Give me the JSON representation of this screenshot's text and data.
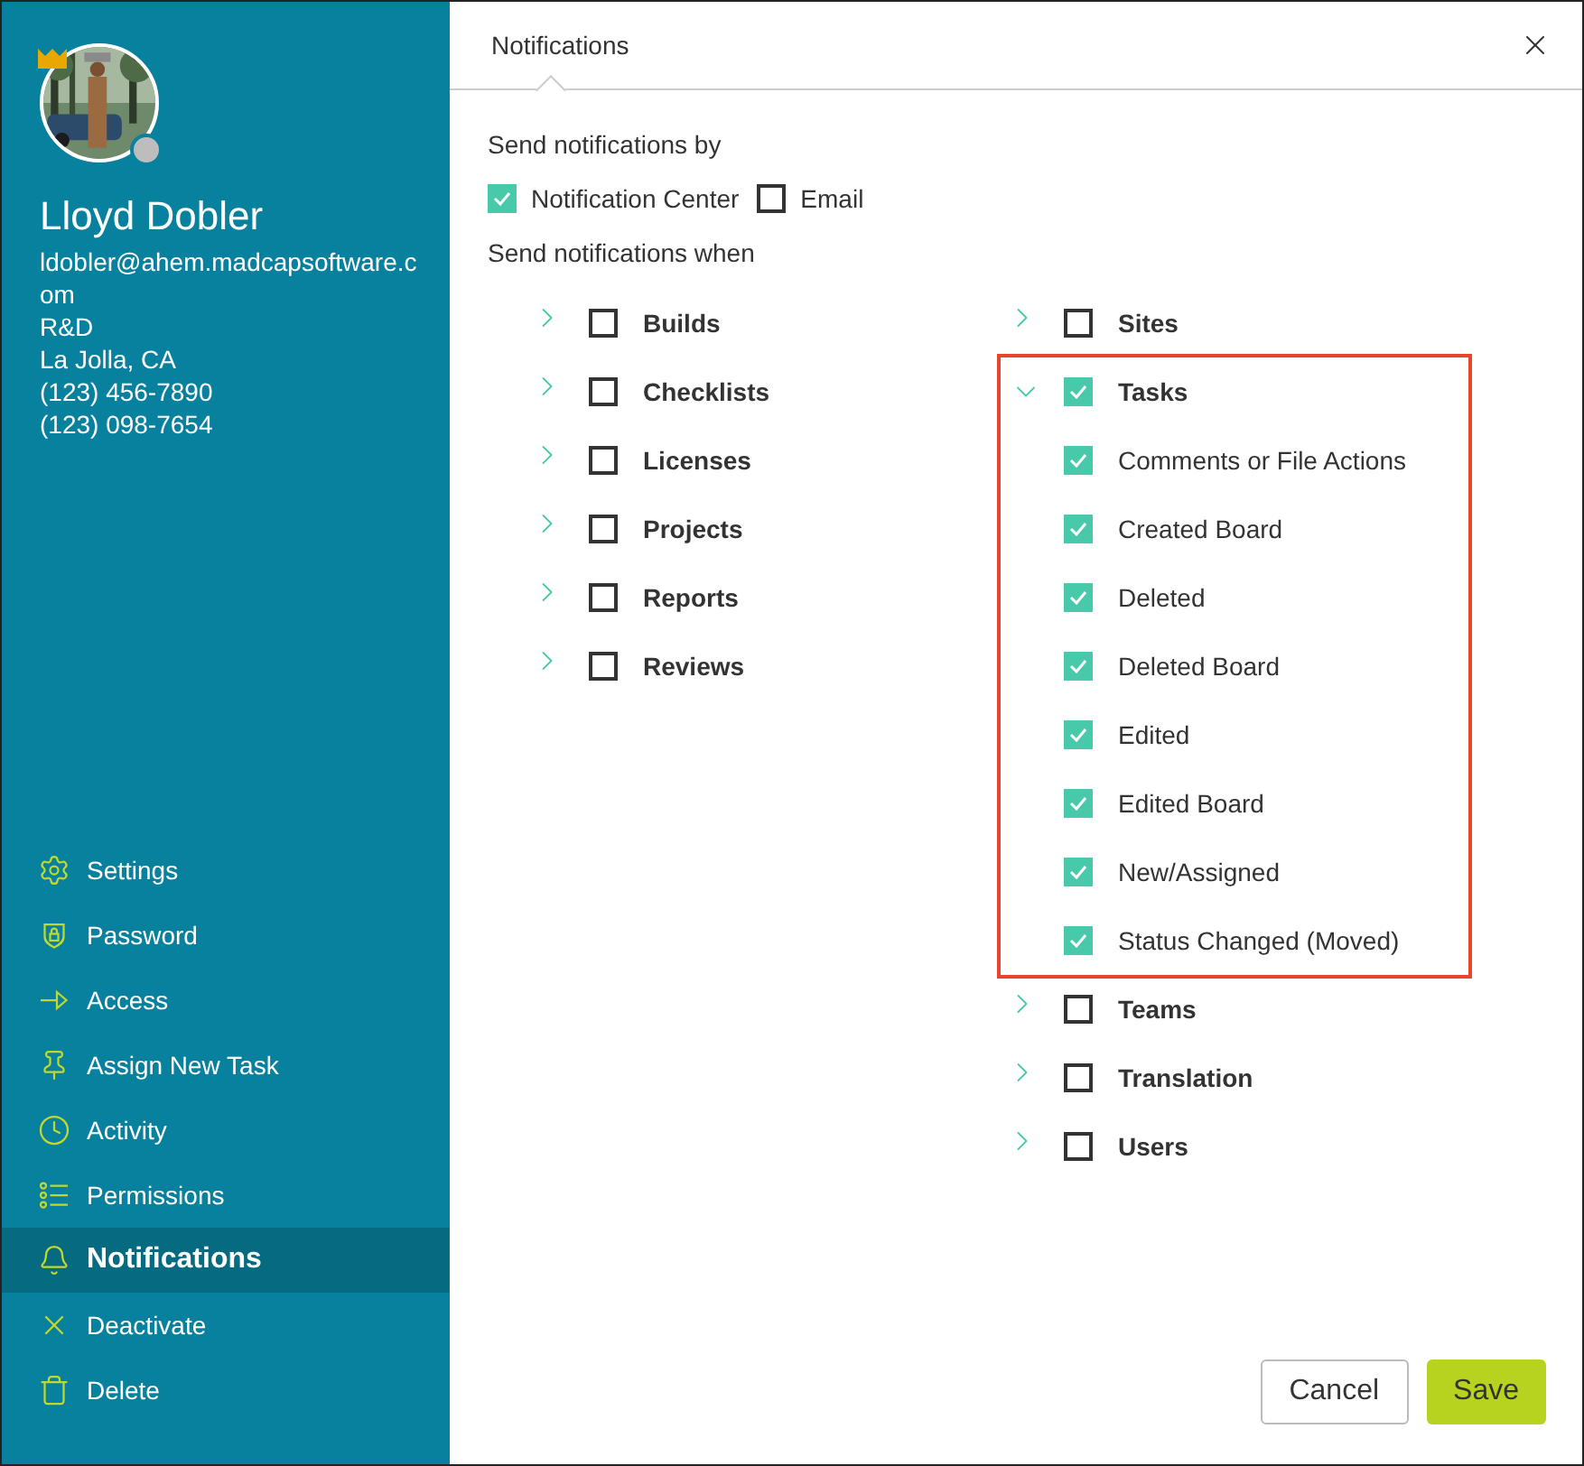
{
  "profile": {
    "name": "Lloyd Dobler",
    "crown": true,
    "online": false,
    "details": [
      "ldobler@ahem.madcapsoftware.com",
      "R&D",
      "La Jolla, CA",
      "(123) 456-7890",
      "(123) 098-7654"
    ]
  },
  "nav": [
    {
      "label": "Settings",
      "kind": "gear",
      "selected": false
    },
    {
      "label": "Password",
      "kind": "shield",
      "selected": false
    },
    {
      "label": "Access",
      "kind": "arrow",
      "selected": false
    },
    {
      "label": "Assign New Task",
      "kind": "pin",
      "selected": false
    },
    {
      "label": "Activity",
      "kind": "clock",
      "selected": false
    },
    {
      "label": "Permissions",
      "kind": "list",
      "selected": false
    },
    {
      "label": "Notifications",
      "kind": "bell",
      "selected": true
    },
    {
      "label": "Deactivate",
      "kind": "x",
      "selected": false
    },
    {
      "label": "Delete",
      "kind": "trash",
      "selected": false
    }
  ],
  "dialog": {
    "title": "Notifications",
    "by_label": "Send notifications by",
    "channels": [
      {
        "label": "Notification Center",
        "checked": true
      },
      {
        "label": "Email",
        "checked": false
      }
    ],
    "when_label": "Send notifications when",
    "columns": [
      [
        {
          "label": "Builds",
          "checked": false,
          "expanded": false,
          "highlighted": false
        },
        {
          "label": "Checklists",
          "checked": false,
          "expanded": false,
          "highlighted": false
        },
        {
          "label": "Licenses",
          "checked": false,
          "expanded": false,
          "highlighted": false
        },
        {
          "label": "Projects",
          "checked": false,
          "expanded": false,
          "highlighted": false
        },
        {
          "label": "Reports",
          "checked": false,
          "expanded": false,
          "highlighted": false
        },
        {
          "label": "Reviews",
          "checked": false,
          "expanded": false,
          "highlighted": false
        }
      ],
      [
        {
          "label": "Sites",
          "checked": false,
          "expanded": false,
          "highlighted": false
        },
        {
          "label": "Tasks",
          "checked": true,
          "expanded": true,
          "highlighted": true,
          "children": [
            {
              "label": "Comments or File Actions",
              "checked": true
            },
            {
              "label": "Created Board",
              "checked": true
            },
            {
              "label": "Deleted",
              "checked": true
            },
            {
              "label": "Deleted Board",
              "checked": true
            },
            {
              "label": "Edited",
              "checked": true
            },
            {
              "label": "Edited Board",
              "checked": true
            },
            {
              "label": "New/Assigned",
              "checked": true
            },
            {
              "label": "Status Changed (Moved)",
              "checked": true
            }
          ]
        },
        {
          "label": "Teams",
          "checked": false,
          "expanded": false,
          "highlighted": false
        },
        {
          "label": "Translation",
          "checked": false,
          "expanded": false,
          "highlighted": false
        },
        {
          "label": "Users",
          "checked": false,
          "expanded": false,
          "highlighted": false
        }
      ]
    ],
    "buttons": [
      {
        "label": "Cancel",
        "kind": "secondary"
      },
      {
        "label": "Save",
        "kind": "primary"
      }
    ]
  }
}
